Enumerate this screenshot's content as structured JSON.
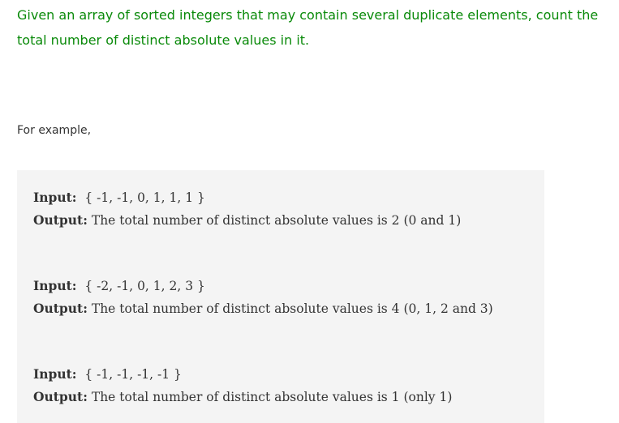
{
  "intro": {
    "text": "Given an array of sorted integers that may contain several duplicate elements, count the total number of distinct absolute values in it."
  },
  "example_label": "For example,",
  "examples": [
    {
      "input_label": "Input:",
      "input_value": "{ -1, -1, 0, 1, 1, 1 }",
      "output_label": "Output:",
      "output_value": "The total number of distinct absolute values is 2 (0 and 1)"
    },
    {
      "input_label": "Input:",
      "input_value": "{ -2, -1, 0, 1, 2, 3 }",
      "output_label": "Output:",
      "output_value": "The total number of distinct absolute values is 4 (0, 1, 2 and 3)"
    },
    {
      "input_label": "Input:",
      "input_value": "{ -1, -1, -1, -1 }",
      "output_label": "Output:",
      "output_value": "The total number of distinct absolute values is 1 (only 1)"
    }
  ]
}
